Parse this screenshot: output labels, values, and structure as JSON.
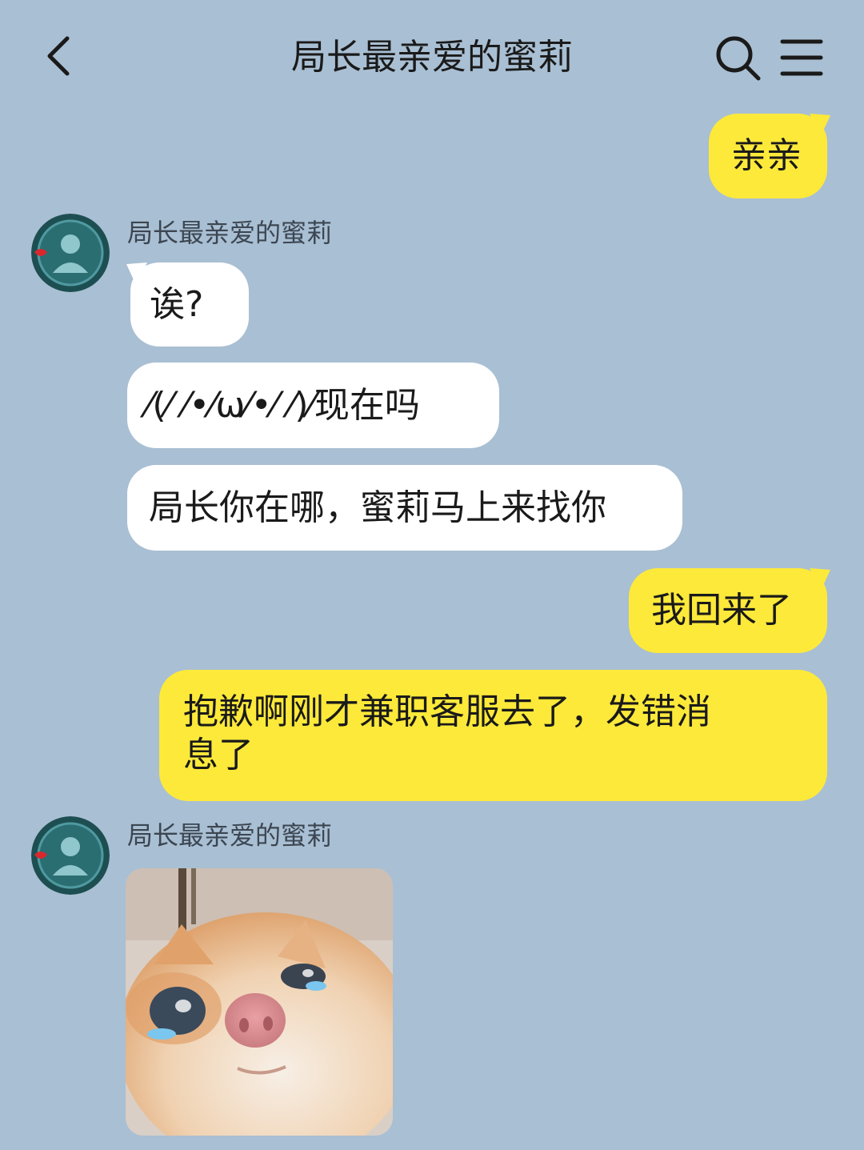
{
  "header": {
    "title": "局长最亲爱的蜜莉",
    "back_icon": "chevron-left-icon",
    "search_icon": "search-icon",
    "menu_icon": "menu-icon"
  },
  "messages": [
    {
      "from": "me",
      "text": "亲亲"
    },
    {
      "from": "them",
      "sender": "局长最亲爱的蜜莉",
      "text": "诶?"
    },
    {
      "from": "them",
      "text": "⁄(⁄ ⁄•⁄ω⁄•⁄ ⁄)⁄现在吗"
    },
    {
      "from": "them",
      "text": "局长你在哪，蜜莉马上来找你"
    },
    {
      "from": "me",
      "text": "我回来了"
    },
    {
      "from": "me",
      "text_line1": "抱歉啊刚才兼职客服去了，发错消",
      "text_line2": "息了"
    },
    {
      "from": "them",
      "sender": "局长最亲爱的蜜莉",
      "sticker": "crying-kitten-sticker"
    }
  ],
  "colors": {
    "background": "#a9bfd3",
    "my_bubble": "#fde93a",
    "their_bubble": "#ffffff",
    "avatar": "#2b6e72"
  }
}
